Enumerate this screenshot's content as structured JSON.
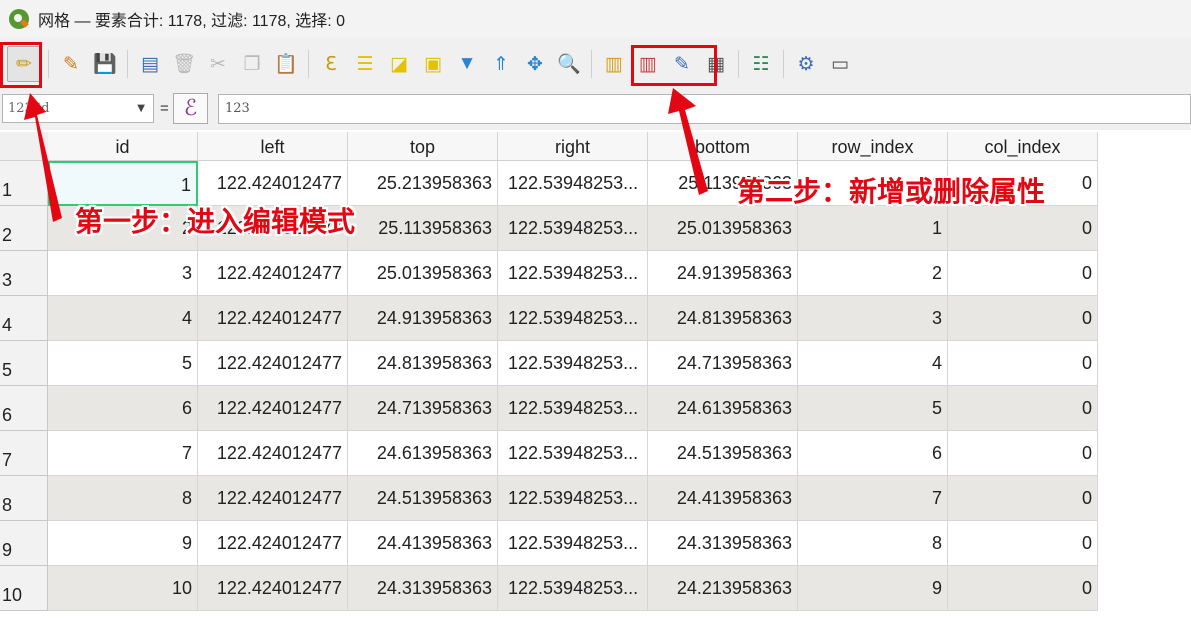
{
  "window": {
    "title": "网格 — 要素合计: 1178, 过滤: 1178, 选择: 0"
  },
  "toolbar": {
    "buttons": [
      {
        "icon": "toggle-editing-icon",
        "glyph": "✏",
        "color": "#c89b16"
      },
      {
        "icon": "multi-edit-icon",
        "glyph": "✎",
        "color": "#d6791a"
      },
      {
        "icon": "save-edits-icon",
        "glyph": "💾",
        "color": "#b9b9b9"
      },
      {
        "icon": "add-feature-icon",
        "glyph": "▤",
        "color": "#3d6fb0"
      },
      {
        "icon": "delete-feature-icon",
        "glyph": "🗑",
        "color": "#b9b9b9"
      },
      {
        "icon": "cut-icon",
        "glyph": "✂",
        "color": "#b9b9b9"
      },
      {
        "icon": "copy-icon",
        "glyph": "❐",
        "color": "#b9b9b9"
      },
      {
        "icon": "paste-icon",
        "glyph": "📋",
        "color": "#777777"
      },
      {
        "icon": "select-by-expression-icon",
        "glyph": "ℇ",
        "color": "#c59d05"
      },
      {
        "icon": "select-all-icon",
        "glyph": "☰",
        "color": "#e5c100"
      },
      {
        "icon": "invert-selection-icon",
        "glyph": "◪",
        "color": "#e5c100"
      },
      {
        "icon": "deselect-all-icon",
        "glyph": "▣",
        "color": "#e5c100"
      },
      {
        "icon": "filter-icon",
        "glyph": "▼",
        "color": "#2a86d1"
      },
      {
        "icon": "move-selection-top-icon",
        "glyph": "⇑",
        "color": "#2a86d1"
      },
      {
        "icon": "pan-to-selected-icon",
        "glyph": "✥",
        "color": "#2a86d1"
      },
      {
        "icon": "zoom-to-selected-icon",
        "glyph": "🔍",
        "color": "#777777"
      },
      {
        "icon": "new-field-icon",
        "glyph": "▥",
        "color": "#d6a21c"
      },
      {
        "icon": "delete-field-icon",
        "glyph": "▥",
        "color": "#c44"
      },
      {
        "icon": "field-calculator-icon",
        "glyph": "✎",
        "color": "#3d6fb0"
      },
      {
        "icon": "conditional-formatting-icon",
        "glyph": "▦",
        "color": "#555555"
      },
      {
        "icon": "dock-icon",
        "glyph": "☷",
        "color": "#2e8b57"
      },
      {
        "icon": "actions-icon",
        "glyph": "⚙",
        "color": "#3d6fb0"
      },
      {
        "icon": "window-icon",
        "glyph": "▭",
        "color": "#555555"
      }
    ]
  },
  "expression_bar": {
    "field_combo": "123 id",
    "equals": "=",
    "epsilon": "ℰ",
    "value": "123"
  },
  "table": {
    "columns": [
      "id",
      "left",
      "top",
      "right",
      "bottom",
      "row_index",
      "col_index"
    ],
    "rows": [
      {
        "num": "1",
        "cells": [
          "1",
          "122.424012477",
          "25.213958363",
          "122.53948253...",
          "25.113958363",
          "0",
          "0"
        ]
      },
      {
        "num": "2",
        "cells": [
          "2",
          "122.424012477",
          "25.113958363",
          "122.53948253...",
          "25.013958363",
          "1",
          "0"
        ]
      },
      {
        "num": "3",
        "cells": [
          "3",
          "122.424012477",
          "25.013958363",
          "122.53948253...",
          "24.913958363",
          "2",
          "0"
        ]
      },
      {
        "num": "4",
        "cells": [
          "4",
          "122.424012477",
          "24.913958363",
          "122.53948253...",
          "24.813958363",
          "3",
          "0"
        ]
      },
      {
        "num": "5",
        "cells": [
          "5",
          "122.424012477",
          "24.813958363",
          "122.53948253...",
          "24.713958363",
          "4",
          "0"
        ]
      },
      {
        "num": "6",
        "cells": [
          "6",
          "122.424012477",
          "24.713958363",
          "122.53948253...",
          "24.613958363",
          "5",
          "0"
        ]
      },
      {
        "num": "7",
        "cells": [
          "7",
          "122.424012477",
          "24.613958363",
          "122.53948253...",
          "24.513958363",
          "6",
          "0"
        ]
      },
      {
        "num": "8",
        "cells": [
          "8",
          "122.424012477",
          "24.513958363",
          "122.53948253...",
          "24.413958363",
          "7",
          "0"
        ]
      },
      {
        "num": "9",
        "cells": [
          "9",
          "122.424012477",
          "24.413958363",
          "122.53948253...",
          "24.313958363",
          "8",
          "0"
        ]
      },
      {
        "num": "10",
        "cells": [
          "10",
          "122.424012477",
          "24.313958363",
          "122.53948253...",
          "24.213958363",
          "9",
          "0"
        ]
      }
    ]
  },
  "annotations": {
    "step1": "第一步：进入编辑模式",
    "step2": "第二步：新增或删除属性",
    "color": "#e30613"
  }
}
